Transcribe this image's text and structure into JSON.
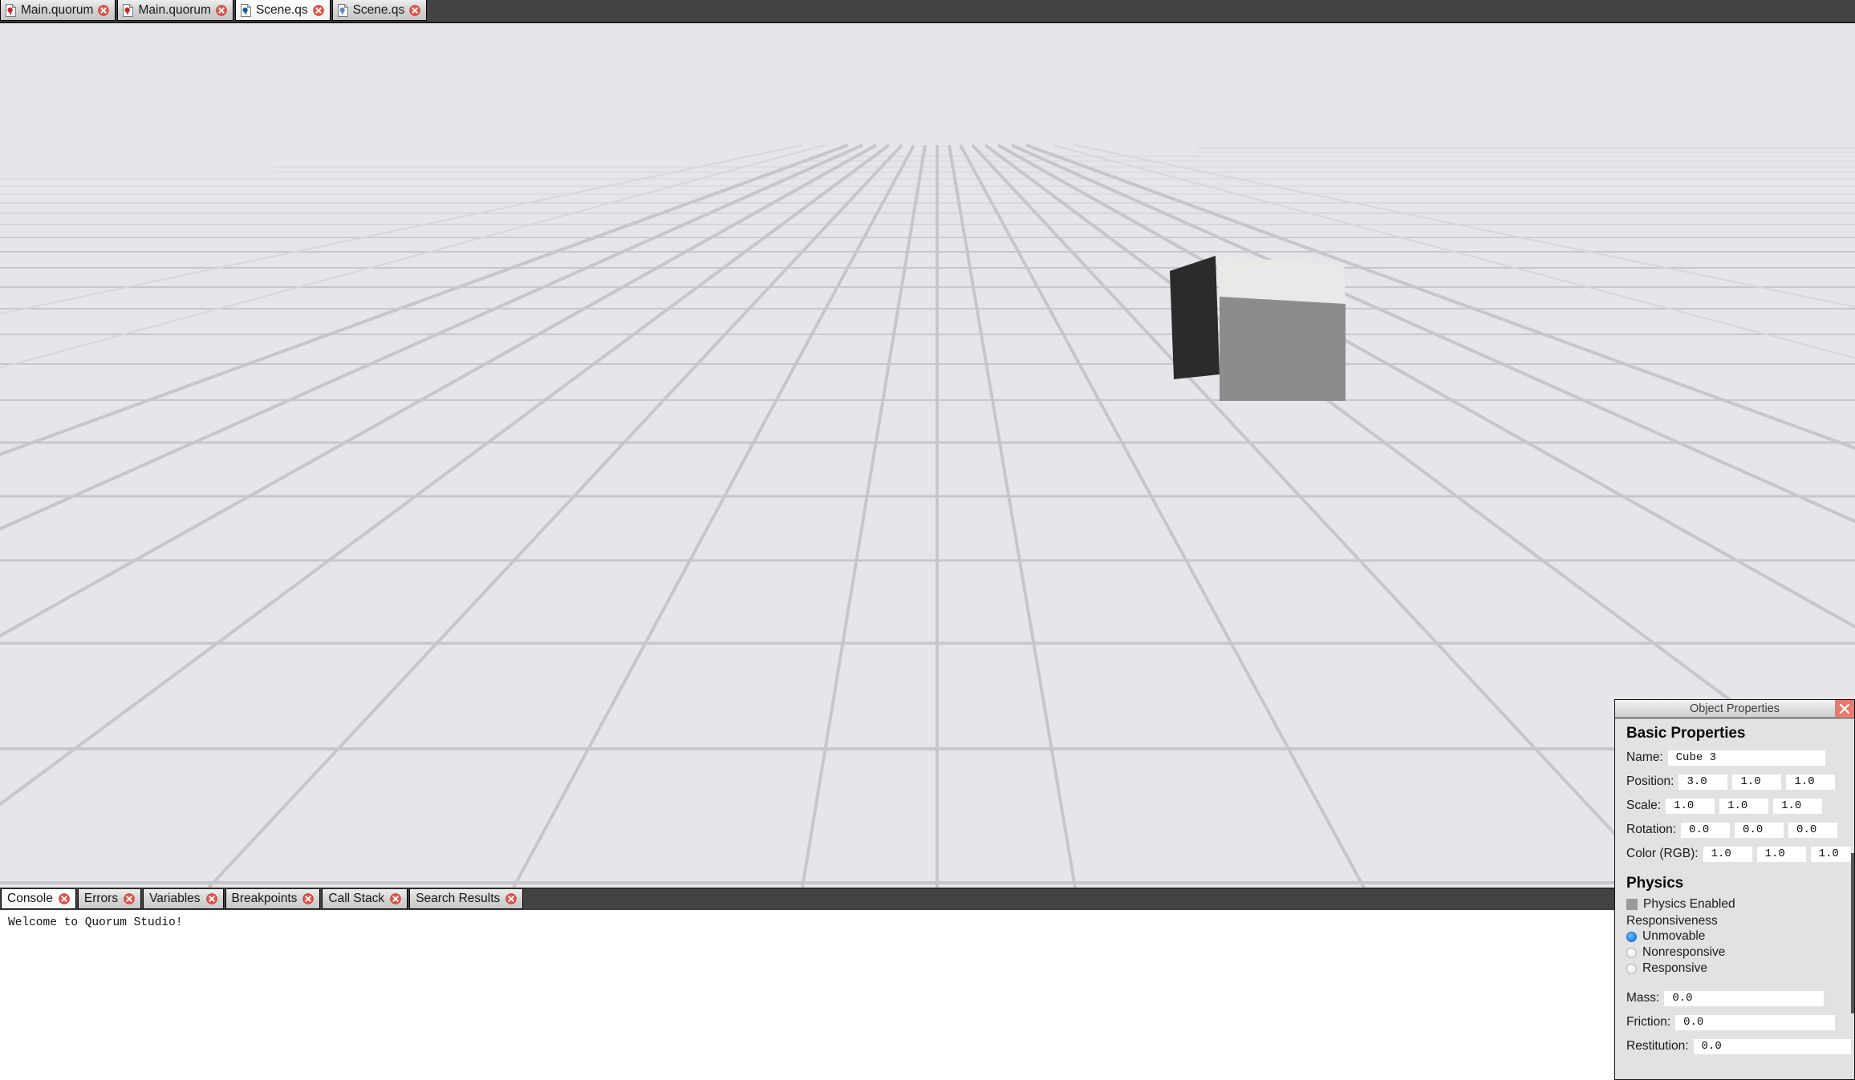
{
  "window": {
    "app_name": "Quorum Studio"
  },
  "editor_tabs": [
    {
      "label": "Main.quorum",
      "icon": "quorum-file-icon",
      "close_icon": "close-icon",
      "active": false
    },
    {
      "label": "Main.quorum",
      "icon": "quorum-file-icon",
      "close_icon": "close-icon",
      "active": false
    },
    {
      "label": "Scene.qs",
      "icon": "scene-file-icon",
      "close_icon": "close-icon",
      "active": true
    },
    {
      "label": "Scene.qs",
      "icon": "scene-file-icon",
      "close_icon": "close-icon",
      "active": false
    }
  ],
  "viewport": {
    "background_color": "#e6e6ea",
    "grid_color": "#c6c6cc",
    "grid_minor_color": "#d6d6dc",
    "object": {
      "name": "Cube 3",
      "top_face_color": "#e9e9e7",
      "front_face_color": "#8c8c8c",
      "left_face_color": "#2b2b2b"
    }
  },
  "properties_panel": {
    "title": "Object Properties",
    "close_icon": "close-icon",
    "basic_section_title": "Basic Properties",
    "name_label": "Name:",
    "name_value": "Cube 3",
    "position_label": "Position:",
    "position_values": [
      "3.0",
      "1.0",
      "1.0"
    ],
    "scale_label": "Scale:",
    "scale_values": [
      "1.0",
      "1.0",
      "1.0"
    ],
    "rotation_label": "Rotation:",
    "rotation_values": [
      "0.0",
      "0.0",
      "0.0"
    ],
    "color_label": "Color (RGB):",
    "color_values": [
      "1.0",
      "1.0",
      "1.0"
    ],
    "physics_section_title": "Physics",
    "physics_enabled_label": "Physics Enabled",
    "physics_enabled_checked": false,
    "responsiveness_label": "Responsiveness",
    "responsiveness_options": [
      {
        "label": "Unmovable",
        "selected": true
      },
      {
        "label": "Nonresponsive",
        "selected": false
      },
      {
        "label": "Responsive",
        "selected": false
      }
    ],
    "mass_label": "Mass:",
    "mass_value": "0.0",
    "friction_label": "Friction:",
    "friction_value": "0.0",
    "restitution_label": "Restitution:",
    "restitution_value": "0.0",
    "accent_color": "#2f8ff0"
  },
  "output_tabs": [
    {
      "label": "Console",
      "close_icon": "close-icon",
      "active": true
    },
    {
      "label": "Errors",
      "close_icon": "close-icon",
      "active": false
    },
    {
      "label": "Variables",
      "close_icon": "close-icon",
      "active": false
    },
    {
      "label": "Breakpoints",
      "close_icon": "close-icon",
      "active": false
    },
    {
      "label": "Call Stack",
      "close_icon": "close-icon",
      "active": false
    },
    {
      "label": "Search Results",
      "close_icon": "close-icon",
      "active": false
    }
  ],
  "console": {
    "lines": [
      "Welcome to Quorum Studio!"
    ]
  }
}
